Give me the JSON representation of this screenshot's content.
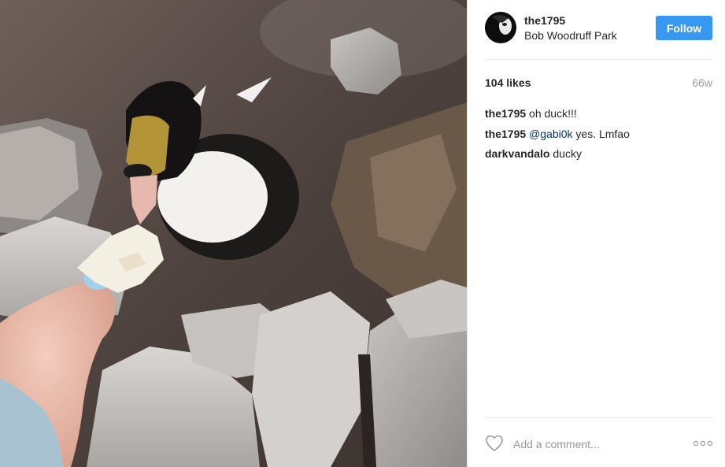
{
  "post": {
    "username": "the1795",
    "location": "Bob Woodruff Park",
    "follow_label": "Follow",
    "likes": "104 likes",
    "time": "66w",
    "comments": [
      {
        "user": "the1795",
        "text": "oh duck!!!",
        "mention": ""
      },
      {
        "user": "the1795",
        "text": " yes. Lmfao",
        "mention": "@gabi0k"
      },
      {
        "user": "darkvandalo",
        "text": "ducky",
        "mention": ""
      }
    ],
    "add_comment_placeholder": "Add a comment..."
  },
  "colors": {
    "follow_button": "#3897f0",
    "mention": "#003569",
    "muted": "#999999"
  },
  "icons": {
    "like": "heart-outline-icon",
    "more": "more-options-icon"
  }
}
